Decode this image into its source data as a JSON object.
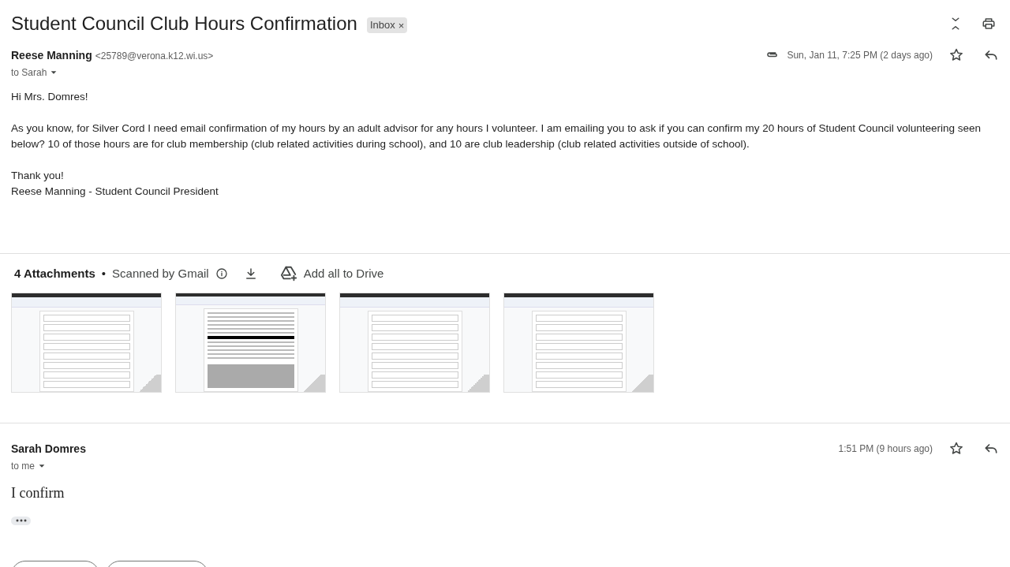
{
  "subject": "Student Council Club Hours Confirmation",
  "label": {
    "text": "Inbox",
    "remove": "×"
  },
  "messages": [
    {
      "sender": "Reese Manning",
      "email": "<25789@verona.k12.wi.us>",
      "to": "to Sarah",
      "has_attachment": true,
      "date": "Sun, Jan 11, 7:25 PM (2 days ago)",
      "starred": false,
      "kind": "formatted",
      "body": [
        [
          "Hi Mrs. Domres!"
        ],
        [
          "As you know, for Silver Cord I need email confirmation of my hours by an adult advisor for any hours I volunteer. I am emailing you to ask if you can confirm my 20 hours of Student Council volunteering seen below? 10 of those hours are for club membership (club related activities during school), and 10 are club leadership (club related activities outside of school)."
        ],
        [
          "Thank you!",
          "Reese Manning - Student Council President"
        ]
      ],
      "attachments": {
        "count": "4 Attachments",
        "separator": "•",
        "scan": "Scanned by Gmail",
        "drive": "Add all to Drive",
        "files": [
          {
            "kind": "table"
          },
          {
            "kind": "form"
          },
          {
            "kind": "table"
          },
          {
            "kind": "table"
          }
        ]
      }
    },
    {
      "sender": "Sarah Domres",
      "to": "to me",
      "date": "1:51 PM (9 hours ago)",
      "starred": false,
      "kind": "plain",
      "body": [
        [
          "I confirm"
        ]
      ],
      "trimmed": true
    }
  ]
}
